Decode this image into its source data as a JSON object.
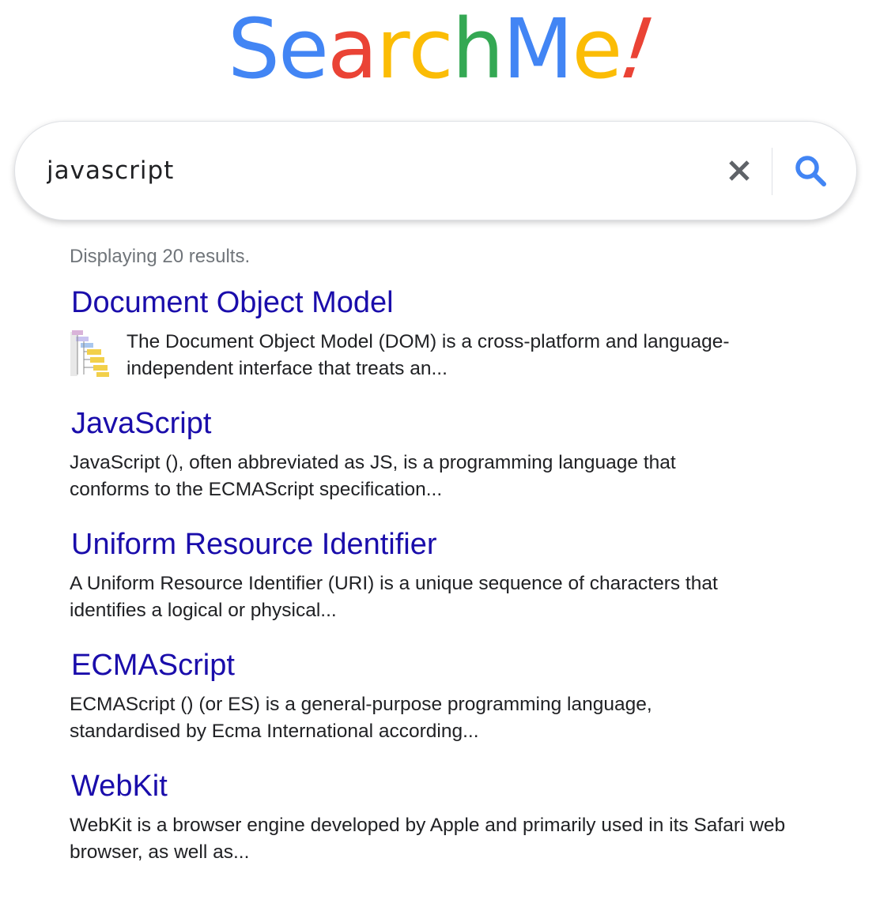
{
  "logo": {
    "letters": [
      {
        "char": "S",
        "color": "#4285F4"
      },
      {
        "char": "e",
        "color": "#4285F4"
      },
      {
        "char": "a",
        "color": "#EA4335"
      },
      {
        "char": "r",
        "color": "#FBBC05"
      },
      {
        "char": "c",
        "color": "#FBBC05"
      },
      {
        "char": "h",
        "color": "#34A853"
      },
      {
        "char": "M",
        "color": "#4285F4"
      },
      {
        "char": "e",
        "color": "#FBBC05"
      },
      {
        "char": "!",
        "color": "#EA4335"
      }
    ]
  },
  "search": {
    "query": "javascript",
    "clear_icon": "close-icon",
    "search_icon": "magnifier-icon",
    "accent_color": "#4285F4"
  },
  "results": {
    "count_text": "Displaying 20 results.",
    "items": [
      {
        "title": "Document Object Model",
        "snippet": "The Document Object Model (DOM) is a cross-platform and language-independent interface that treats an...",
        "has_thumbnail": true
      },
      {
        "title": "JavaScript",
        "snippet": "JavaScript (), often abbreviated as JS, is a programming language that conforms to the ECMAScript specification..."
      },
      {
        "title": "Uniform Resource Identifier",
        "snippet": "A Uniform Resource Identifier (URI) is a unique sequence of characters that identifies a logical or physical..."
      },
      {
        "title": "ECMAScript",
        "snippet": "ECMAScript () (or ES) is a general-purpose programming language, standardised by Ecma International according..."
      },
      {
        "title": "WebKit",
        "snippet": "WebKit is a browser engine developed by Apple and primarily used in its Safari web browser, as well as..."
      }
    ],
    "title_color": "#1a0dab"
  }
}
